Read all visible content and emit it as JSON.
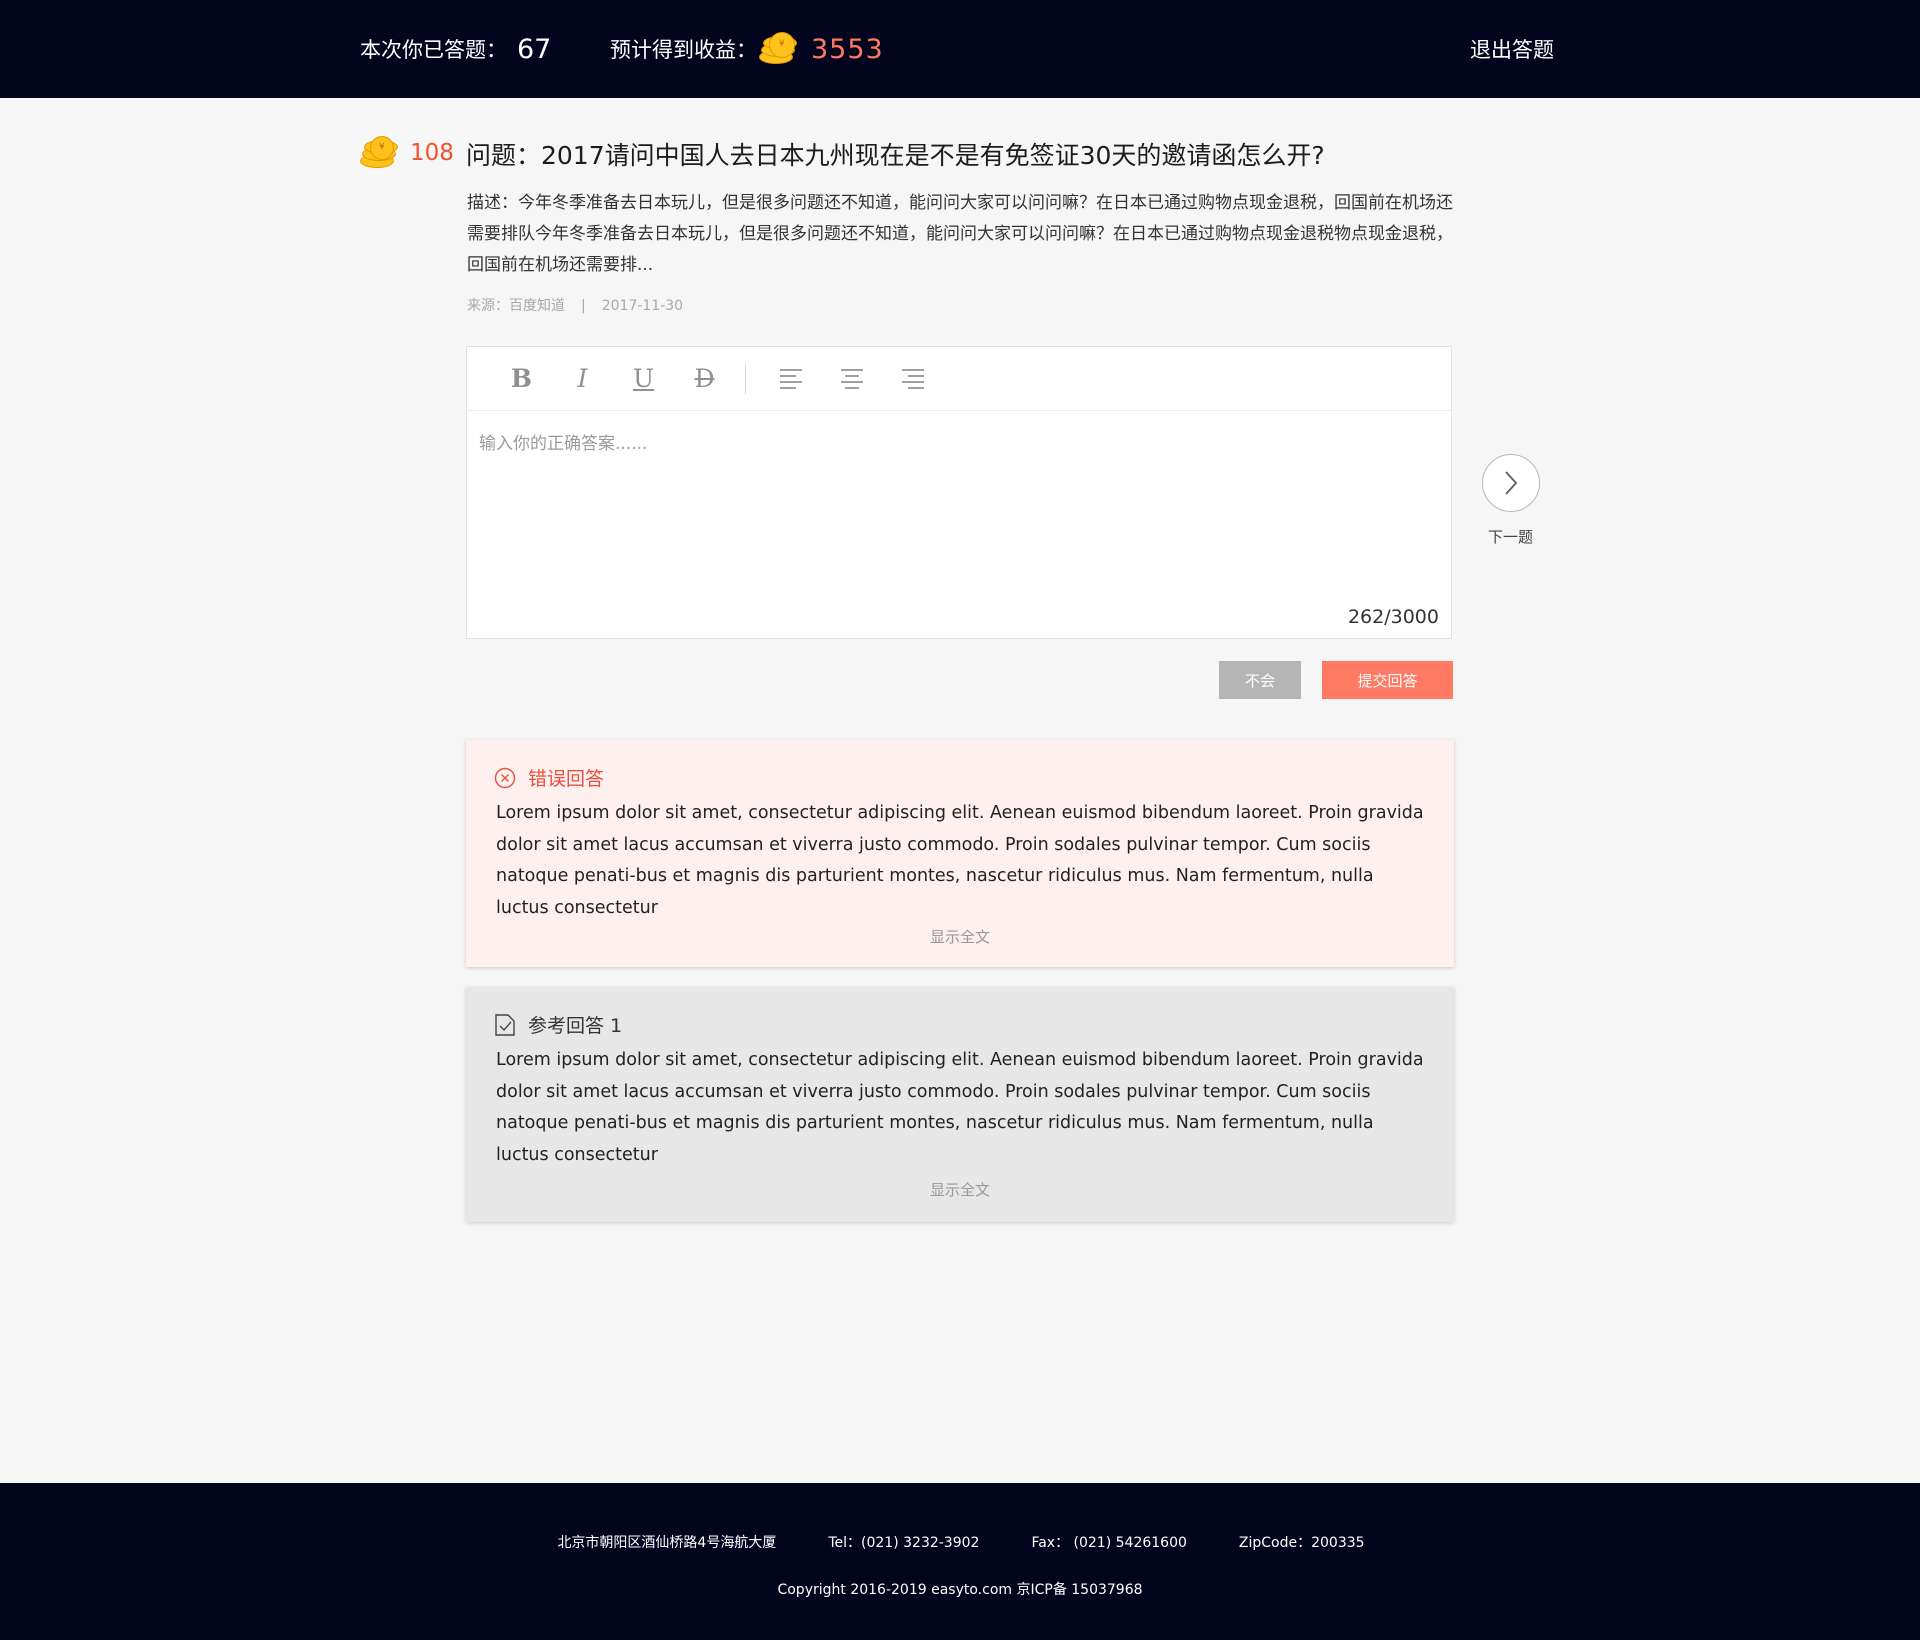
{
  "header": {
    "answered_label": "本次你已答题：",
    "answered_count": "67",
    "earnings_label": "预计得到收益：",
    "earnings_value": "3553",
    "exit_label": "退出答题"
  },
  "question": {
    "reward": "108",
    "title": "问题：2017请问中国人去日本九州现在是不是有免签证30天的邀请函怎么开?",
    "description": "描述：今年冬季准备去日本玩儿，但是很多问题还不知道，能问问大家可以问问嘛？在日本已通过购物点现金退税，回国前在机场还需要排队今年冬季准备去日本玩儿，但是很多问题还不知道，能问问大家可以问问嘛？在日本已通过购物点现金退税物点现金退税，回国前在机场还需要排...",
    "source": "来源：百度知道",
    "separator": "|",
    "date": "2017-11-30"
  },
  "editor": {
    "toolbar": [
      "B",
      "I",
      "U",
      "D"
    ],
    "placeholder": "输入你的正确答案......",
    "counter": "262/3000"
  },
  "next": {
    "label": "下一题"
  },
  "actions": {
    "skip_label": "不会",
    "submit_label": "提交回答"
  },
  "wrong_answer": {
    "title": "错误回答",
    "body": "Lorem ipsum dolor sit amet, consectetur adipiscing elit. Aenean euismod bibendum laoreet. Proin gravida dolor sit amet lacus accumsan et viverra justo commodo. Proin sodales pulvinar tempor. Cum sociis natoque penati-bus et magnis dis parturient montes, nascetur ridiculus mus. Nam fermentum, nulla luctus consectetur",
    "more": "显示全文"
  },
  "reference_answer": {
    "title": "参考回答 1",
    "body": "Lorem ipsum dolor sit amet, consectetur adipiscing elit. Aenean euismod bibendum laoreet. Proin gravida dolor sit amet lacus accumsan et viverra justo commodo. Proin sodales pulvinar tempor. Cum sociis natoque penati-bus et magnis dis parturient montes, nascetur ridiculus mus. Nam fermentum, nulla luctus consectetur",
    "more": "显示全文"
  },
  "footer": {
    "address": "北京市朝阳区酒仙桥路4号海航大厦",
    "tel": "Tel：(021) 3232-3902",
    "fax": "Fax： (021) 54261600",
    "zip": "ZipCode：200335",
    "copyright": "Copyright 2016-2019 easyto.com 京ICP备 15037968"
  },
  "colors": {
    "header_bg": "#03041e",
    "accent": "#ff7a62",
    "error": "#e8503a",
    "coin": "#ffc21a"
  },
  "icons": [
    "coin-stack-icon",
    "bold-icon",
    "italic-icon",
    "underline-icon",
    "strikethrough-icon",
    "align-left-icon",
    "align-center-icon",
    "align-right-icon",
    "chevron-right-icon",
    "error-circle-icon",
    "checklist-icon"
  ]
}
